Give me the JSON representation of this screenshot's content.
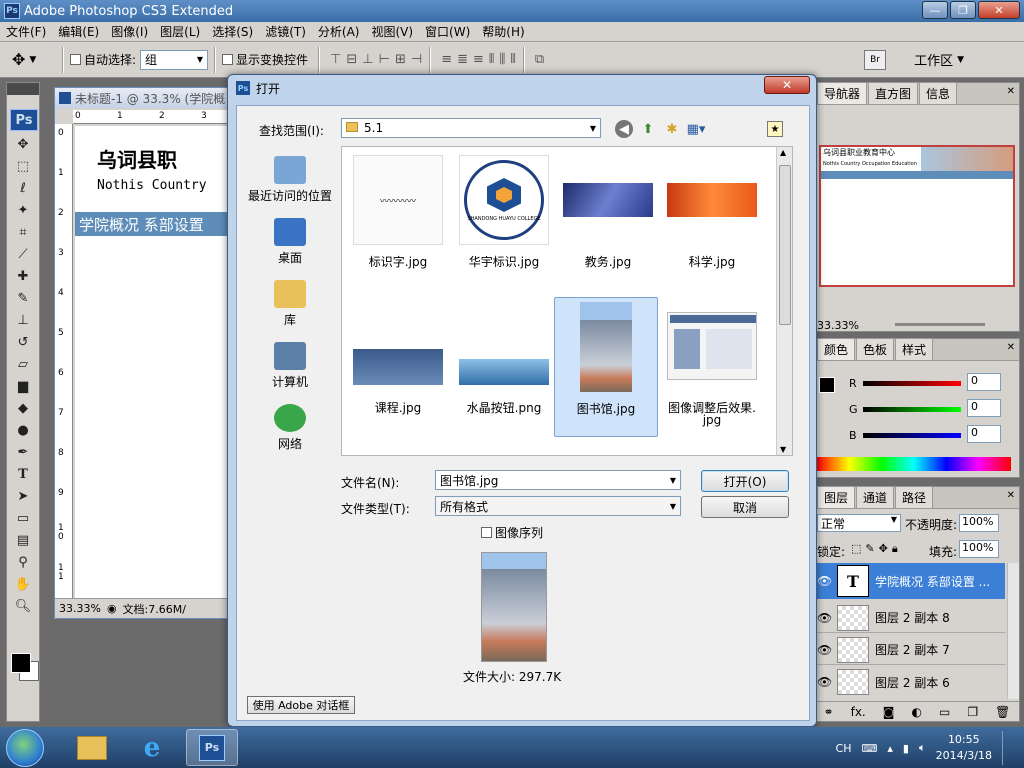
{
  "app": {
    "title": "Adobe Photoshop CS3 Extended",
    "logo": "Ps"
  },
  "window_controls": {
    "minimize": "—",
    "restore": "❐",
    "close": "✕"
  },
  "menu": [
    "文件(F)",
    "编辑(E)",
    "图像(I)",
    "图层(L)",
    "选择(S)",
    "滤镜(T)",
    "分析(A)",
    "视图(V)",
    "窗口(W)",
    "帮助(H)"
  ],
  "options": {
    "auto_select_label": "自动选择:",
    "auto_select_value": "组",
    "show_transform_label": "显示变换控件",
    "workspace_label": "工作区",
    "bridge": "Br"
  },
  "tools": {
    "badge": "Ps",
    "items": [
      "move-tool",
      "marquee-tool",
      "lasso-tool",
      "magic-wand-tool",
      "crop-tool",
      "slice-tool",
      "healing-tool",
      "brush-tool",
      "stamp-tool",
      "history-brush-tool",
      "eraser-tool",
      "gradient-tool",
      "blur-tool",
      "dodge-tool",
      "pen-tool",
      "type-tool",
      "path-select-tool",
      "shape-tool",
      "notes-tool",
      "eyedropper-tool",
      "hand-tool",
      "zoom-tool"
    ]
  },
  "document": {
    "title": "未标题-1 @ 33.3% (学院概",
    "ruler_top": [
      "0",
      "1",
      "2",
      "3"
    ],
    "ruler_left": [
      "0",
      "1",
      "2",
      "3",
      "4",
      "5",
      "6",
      "7",
      "8",
      "9",
      "1\n0",
      "1\n1"
    ],
    "canvas_title": "乌词县职",
    "canvas_subtitle": "Nothis Country",
    "canvas_nav": "学院概况 系部设置",
    "zoom": "33.33%",
    "doc_size": "文档:7.66M/"
  },
  "panels": {
    "navigator_tabs": [
      "导航器",
      "直方图",
      "信息"
    ],
    "navigator_zoom": "33.33%",
    "nav_preview_title": "乌词县职业教育中心",
    "nav_preview_sub": "Nothis Country Occupation Education Center",
    "color_tabs": [
      "颜色",
      "色板",
      "样式"
    ],
    "color_channels": [
      {
        "label": "R",
        "value": "0"
      },
      {
        "label": "G",
        "value": "0"
      },
      {
        "label": "B",
        "value": "0"
      }
    ],
    "layers_tabs": [
      "图层",
      "通道",
      "路径"
    ],
    "blend_mode": "正常",
    "opacity_label": "不透明度:",
    "opacity_value": "100%",
    "lock_label": "锁定:",
    "fill_label": "填充:",
    "fill_value": "100%",
    "layers": [
      {
        "name": "学院概况 系部设置 ...",
        "thumb": "T",
        "selected": true
      },
      {
        "name": "图层 2 副本 8",
        "thumb": "",
        "selected": false
      },
      {
        "name": "图层 2 副本 7",
        "thumb": "",
        "selected": false
      },
      {
        "name": "图层 2 副本 6",
        "thumb": "",
        "selected": false
      }
    ],
    "layer_footer": "fx."
  },
  "dialog": {
    "title": "打开",
    "close": "✕",
    "lookin_label": "查找范围(I):",
    "lookin_value": "5.1",
    "places": [
      {
        "label": "最近访问的位置",
        "icon": "recent-places-icon",
        "color": "#7aa6d6"
      },
      {
        "label": "桌面",
        "icon": "desktop-icon",
        "color": "#3b73c4"
      },
      {
        "label": "库",
        "icon": "library-icon",
        "color": "#e8c15b"
      },
      {
        "label": "计算机",
        "icon": "computer-icon",
        "color": "#5c7fa8"
      },
      {
        "label": "网络",
        "icon": "network-icon",
        "color": "#3aa64a"
      }
    ],
    "files": [
      {
        "name": "标识字.jpg",
        "kind": "calligraphy"
      },
      {
        "name": "华宇标识.jpg",
        "kind": "seal"
      },
      {
        "name": "教务.jpg",
        "kind": "banner-blue"
      },
      {
        "name": "科学.jpg",
        "kind": "banner-orange"
      },
      {
        "name": "课程.jpg",
        "kind": "banner-steel"
      },
      {
        "name": "水晶按钮.png",
        "kind": "crystal"
      },
      {
        "name": "图书馆.jpg",
        "kind": "tower"
      },
      {
        "name": "图像调整后效果.",
        "kind": "webpage"
      }
    ],
    "file_extra": "jpg",
    "filename_label": "文件名(N):",
    "filename_value": "图书馆.jpg",
    "filetype_label": "文件类型(T):",
    "filetype_value": "所有格式",
    "open_button": "打开(O)",
    "cancel_button": "取消",
    "sequence_label": "图像序列",
    "filesize": "文件大小: 297.7K",
    "adobe_dialog_button": "使用 Adobe 对话框",
    "seal_text": "SHANDONG HUAYU COLLEGE"
  },
  "taskbar": {
    "lang": "CH",
    "time": "10:55",
    "date": "2014/3/18"
  },
  "colors": {
    "titlebar": "#3a6ea8",
    "selection": "#cfe3fa",
    "layer_selected": "#3b7fd6"
  }
}
